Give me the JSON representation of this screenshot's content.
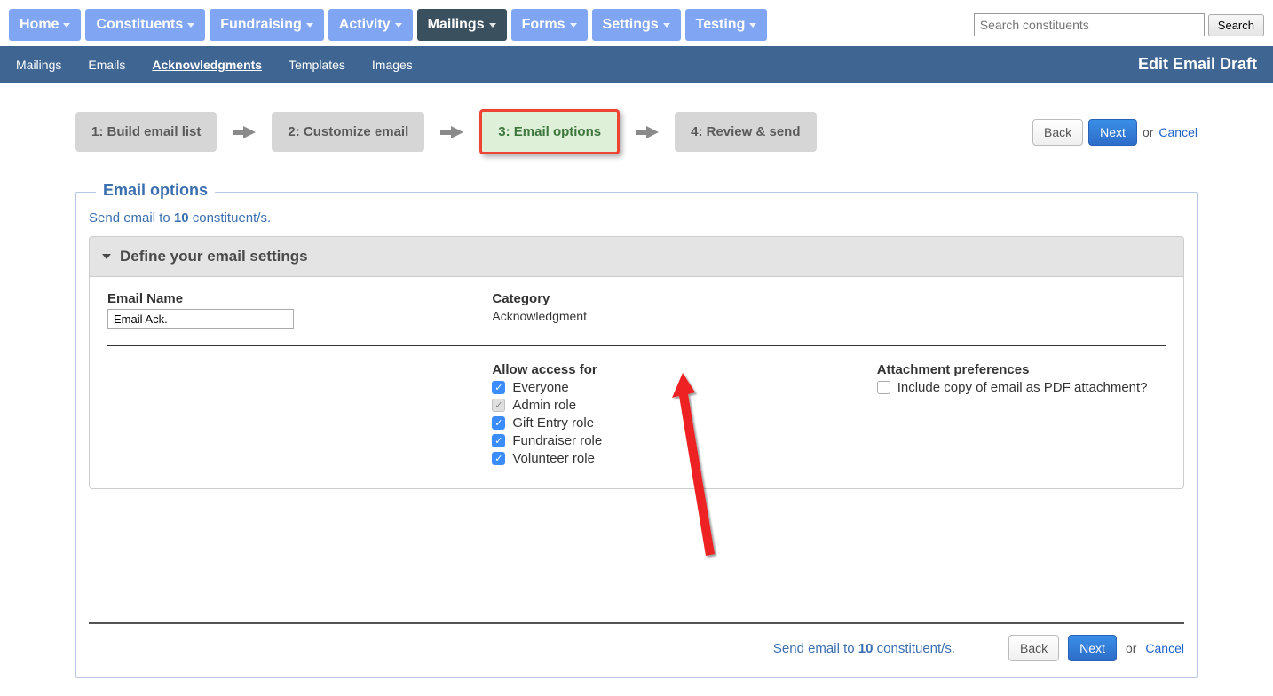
{
  "topnav": {
    "tabs": [
      "Home",
      "Constituents",
      "Fundraising",
      "Activity",
      "Mailings",
      "Forms",
      "Settings",
      "Testing"
    ],
    "active_index": 4,
    "search_placeholder": "Search constituents",
    "search_button": "Search"
  },
  "subnav": {
    "items": [
      "Mailings",
      "Emails",
      "Acknowledgments",
      "Templates",
      "Images"
    ],
    "active_index": 2,
    "page_title": "Edit Email Draft"
  },
  "wizard": {
    "steps": [
      "1: Build email list",
      "2: Customize email",
      "3: Email options",
      "4: Review & send"
    ],
    "current_index": 2,
    "back": "Back",
    "next": "Next",
    "or": "or",
    "cancel": "Cancel"
  },
  "panel": {
    "legend": "Email options",
    "send_prefix": "Send email to ",
    "send_count": "10",
    "send_suffix": " constituent/s.",
    "accordion_title": "Define your email settings",
    "email_name_label": "Email Name",
    "email_name_value": "Email Ack.",
    "category_label": "Category",
    "category_value": "Acknowledgment",
    "access_label": "Allow access for",
    "access_options": [
      {
        "label": "Everyone",
        "state": "checked"
      },
      {
        "label": "Admin role",
        "state": "disabled"
      },
      {
        "label": "Gift Entry role",
        "state": "checked"
      },
      {
        "label": "Fundraiser role",
        "state": "checked"
      },
      {
        "label": "Volunteer role",
        "state": "checked"
      }
    ],
    "attach_label": "Attachment preferences",
    "attach_option": "Include copy of email as PDF attachment?",
    "attach_state": "empty"
  },
  "footer": {
    "send_prefix": "Send email to ",
    "send_count": "10",
    "send_suffix": " constituent/s.",
    "back": "Back",
    "next": "Next",
    "or": "or",
    "cancel": "Cancel"
  }
}
